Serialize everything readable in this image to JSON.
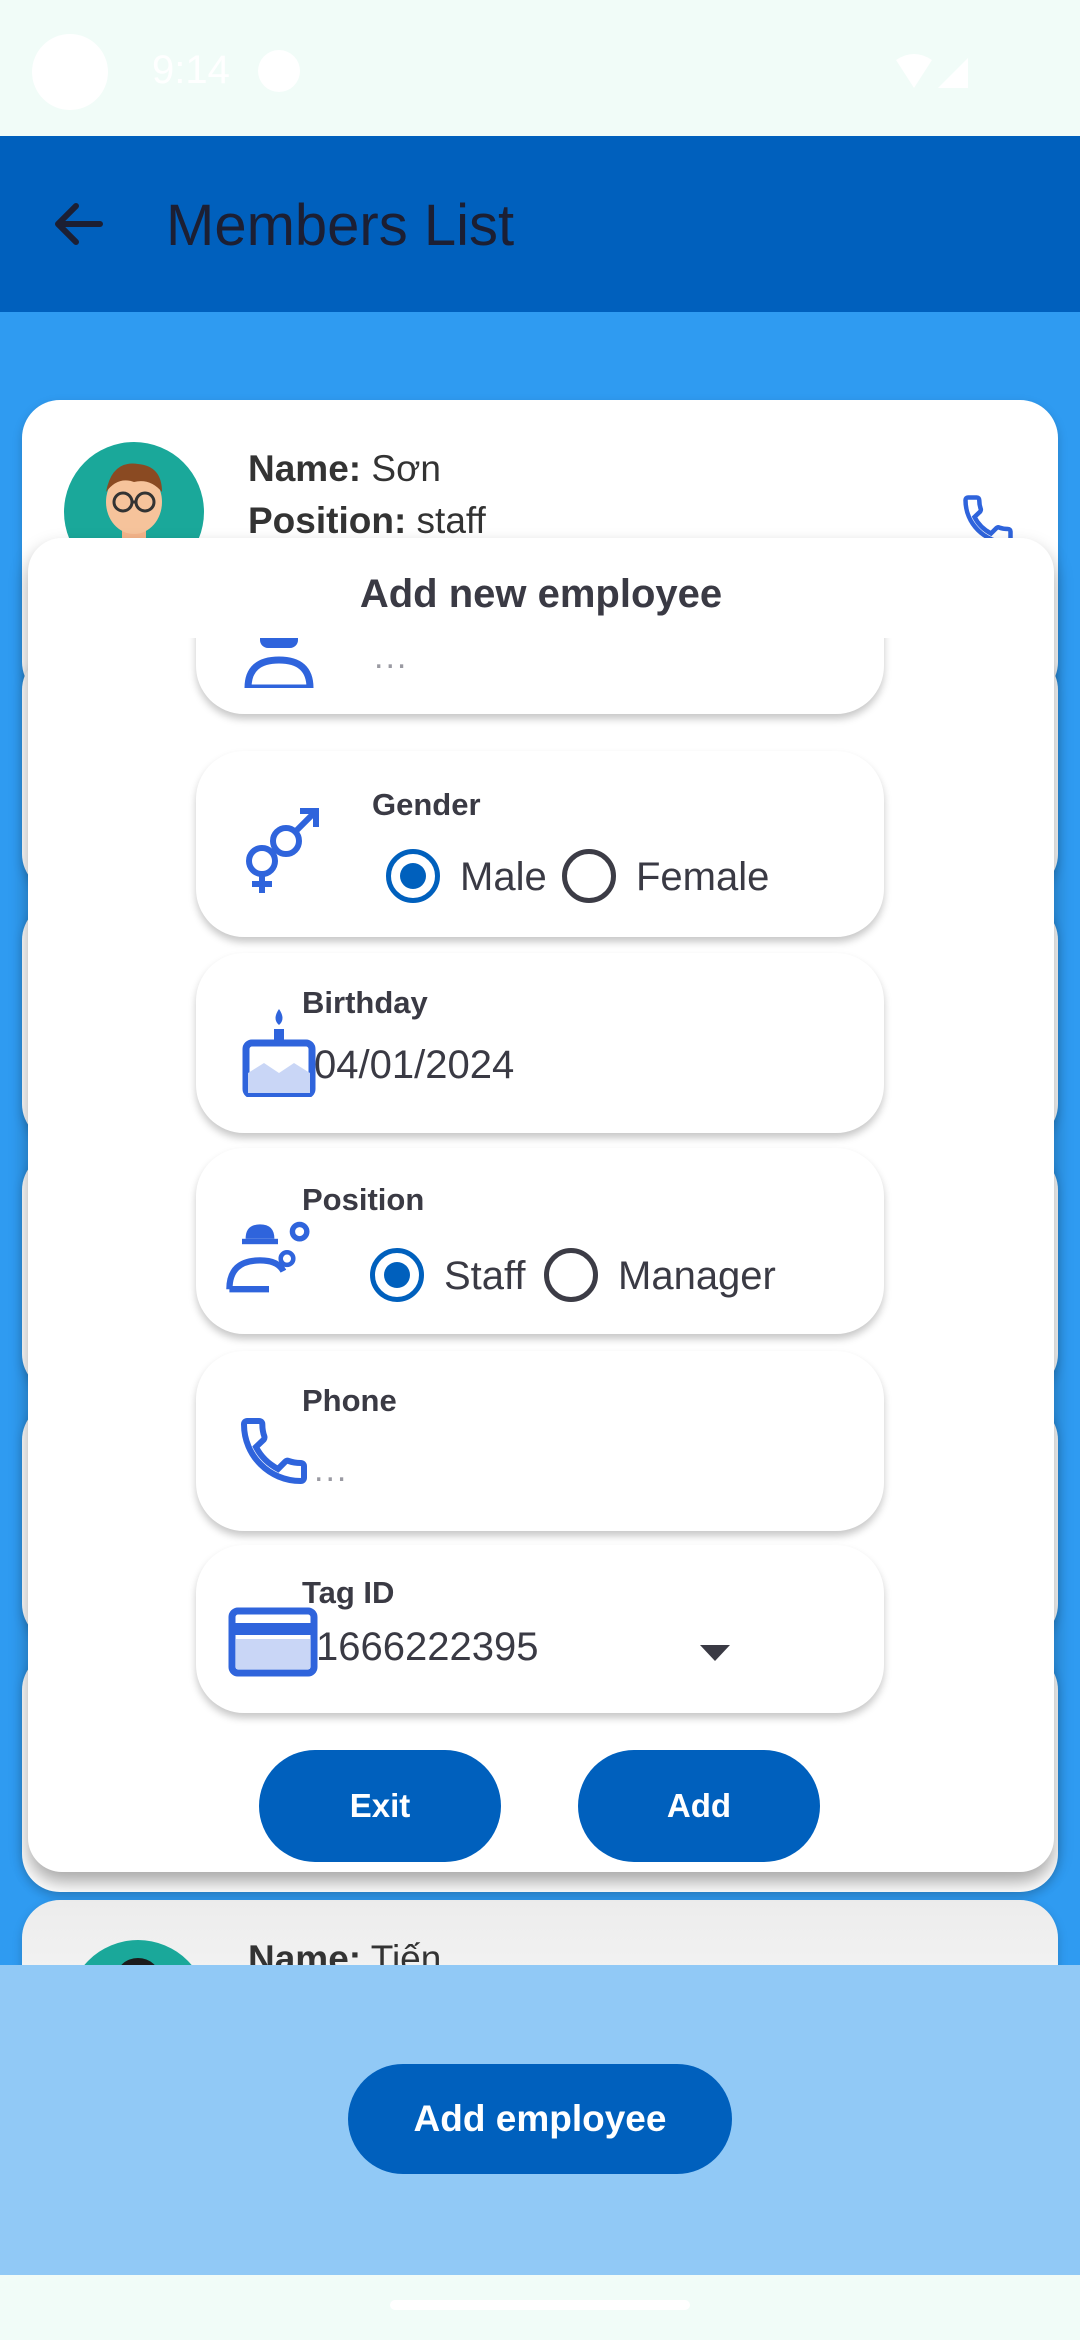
{
  "status_bar": {
    "time": "9:14"
  },
  "app_bar": {
    "title": "Members List"
  },
  "members": [
    {
      "name_label": "Name:",
      "name": "Sơn",
      "position_label": "Position:",
      "position": "staff"
    },
    {
      "name_label": "Name:",
      "name": "Tiến"
    }
  ],
  "dialog": {
    "title": "Add new employee",
    "name_field": {
      "placeholder": "..."
    },
    "gender": {
      "label": "Gender",
      "options": [
        "Male",
        "Female"
      ],
      "selected": "Male"
    },
    "birthday": {
      "label": "Birthday",
      "value": "04/01/2024"
    },
    "position": {
      "label": "Position",
      "options": [
        "Staff",
        "Manager"
      ],
      "selected": "Staff"
    },
    "phone": {
      "label": "Phone",
      "placeholder": "..."
    },
    "tag_id": {
      "label": "Tag ID",
      "value": "1666222395"
    },
    "exit_label": "Exit",
    "add_label": "Add"
  },
  "add_employee_label": "Add employee",
  "colors": {
    "primary": "#0060bd",
    "content_bg": "#2f9bf1",
    "icon_blue": "#2f64dc"
  }
}
